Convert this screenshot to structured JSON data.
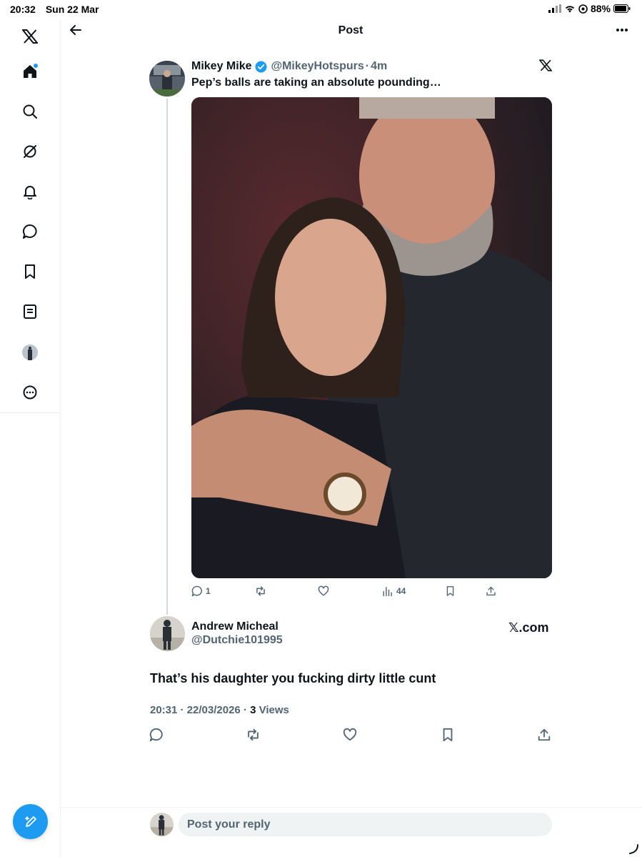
{
  "status_bar": {
    "time": "20:32",
    "date": "Sun 22 Mar",
    "battery": "88%"
  },
  "header": {
    "title": "Post"
  },
  "sidebar": {
    "items": [
      {
        "icon": "x-logo-icon"
      },
      {
        "icon": "home-icon"
      },
      {
        "icon": "search-icon"
      },
      {
        "icon": "grok-icon"
      },
      {
        "icon": "notifications-bell-icon"
      },
      {
        "icon": "messages-icon"
      },
      {
        "icon": "bookmarks-icon"
      },
      {
        "icon": "lists-icon"
      },
      {
        "icon": "profile-avatar"
      },
      {
        "icon": "more-circle-icon"
      }
    ],
    "compose_icon": "compose-post-icon"
  },
  "quoted_post": {
    "name": "Mikey Mike",
    "verified": true,
    "handle": "@MikeyHotspurs",
    "separator": "·",
    "time": "4m",
    "text": "Pep’s balls are taking an absolute pounding…",
    "source_icon": "x-logo-icon",
    "stats": {
      "replies": "1",
      "views": "44"
    }
  },
  "reply_post": {
    "name": "Andrew Micheal",
    "handle": "@Dutchie101995",
    "source_label": "𝕏.com",
    "text": "That’s his daughter you fucking dirty little cunt",
    "timestamp": "20:31 · 22/03/2026 · ",
    "views_count": "3",
    "views_label": " Views"
  },
  "reply_bar": {
    "placeholder": "Post your reply"
  },
  "colors": {
    "accent": "#1d9bf0",
    "text": "#0f1419",
    "muted": "#536471",
    "border": "#eff3f4"
  }
}
